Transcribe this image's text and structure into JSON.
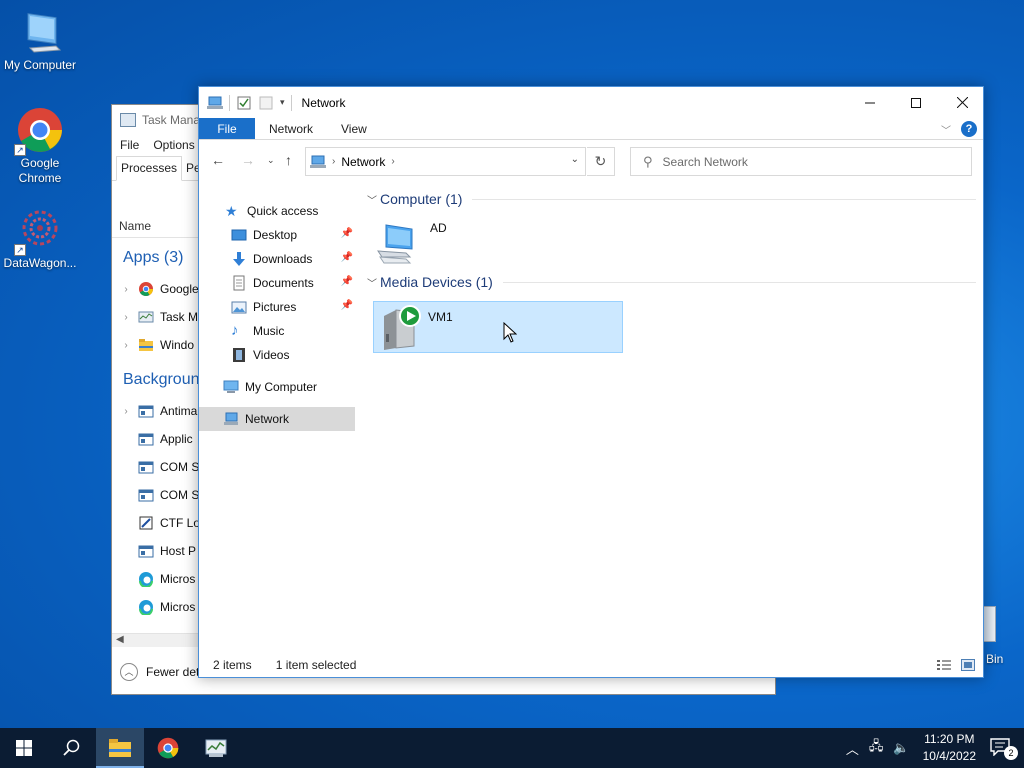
{
  "desktop": {
    "icons": [
      {
        "label": "My Computer"
      },
      {
        "label": "Google\nChrome"
      },
      {
        "label": "DataWagon..."
      }
    ],
    "recycle_bin_label": "Bin"
  },
  "task_manager": {
    "title": "Task Manag",
    "menu": [
      "File",
      "Options"
    ],
    "tabs": [
      "Processes",
      "Pe"
    ],
    "column_header": "Name",
    "groups": {
      "apps": "Apps (3)",
      "background": "Backgroun"
    },
    "apps": [
      "Google",
      "Task M",
      "Windo"
    ],
    "background": [
      "Antima",
      "Applic",
      "COM S",
      "COM S",
      "CTF Lo",
      "Host P",
      "Micros",
      "Micros"
    ],
    "footer": "Fewer det"
  },
  "explorer": {
    "title": "Network",
    "ribbon_tabs": [
      "File",
      "Network",
      "View"
    ],
    "address": {
      "crumb": "Network"
    },
    "search_placeholder": "Search Network",
    "nav": {
      "quick_access": "Quick access",
      "desktop": "Desktop",
      "downloads": "Downloads",
      "documents": "Documents",
      "pictures": "Pictures",
      "music": "Music",
      "videos": "Videos",
      "my_computer": "My Computer",
      "network": "Network"
    },
    "groups": {
      "computer": {
        "heading": "Computer (1)",
        "items": [
          "AD"
        ]
      },
      "media": {
        "heading": "Media Devices (1)",
        "items": [
          "VM1"
        ]
      }
    },
    "status": {
      "count": "2 items",
      "selection": "1 item selected"
    }
  },
  "taskbar": {
    "clock_time": "11:20 PM",
    "clock_date": "10/4/2022",
    "notification_count": "2"
  },
  "colors": {
    "accent": "#1a6fc9",
    "selection": "#cce8ff",
    "taskbar": "#0b1c33"
  }
}
